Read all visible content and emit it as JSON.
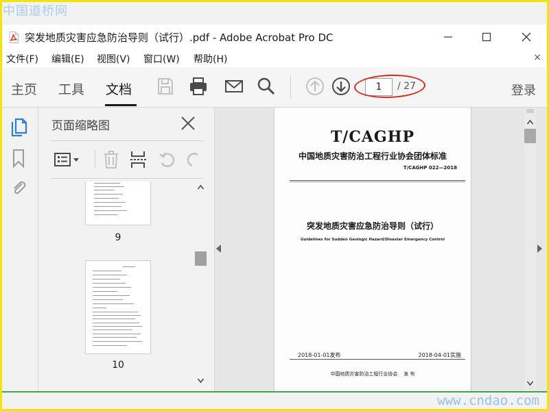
{
  "watermark_top": "中国道桥网",
  "watermark_bottom": "www.cndao.com",
  "window": {
    "title": "突发地质灾害应急防治导则（试行）.pdf - Adobe Acrobat Pro DC"
  },
  "menu": {
    "items": [
      "文件(F)",
      "编辑(E)",
      "视图(V)",
      "窗口(W)",
      "帮助(H)"
    ],
    "close": "×"
  },
  "toolbar": {
    "tabs": [
      "主页",
      "工具",
      "文档"
    ],
    "active_tab": "文档",
    "page_current": "1",
    "page_total": "/ 27",
    "login": "登录"
  },
  "thumbnails": {
    "title": "页面缩略图",
    "pages": [
      "9",
      "10"
    ]
  },
  "document": {
    "code_title": "T/CAGHP",
    "org_standard": "中国地质灾害防治工程行业协会团体标准",
    "standard_no": "T/CAGHP 022—2018",
    "doc_title": "突发地质灾害应急防治导则（试行）",
    "doc_title_en": "Guidelines for Sudden Geologic Hazard/Disaster Emergency Control",
    "issue_date": "2018-01-01发布",
    "impl_date": "2018-04-01实施",
    "publisher": "中国地质灾害防治工程行业协会    发 布"
  },
  "colors": {
    "accent_highlight": "#d52b1e",
    "frame_border": "#f2e600",
    "status_line": "#3fa34d"
  }
}
